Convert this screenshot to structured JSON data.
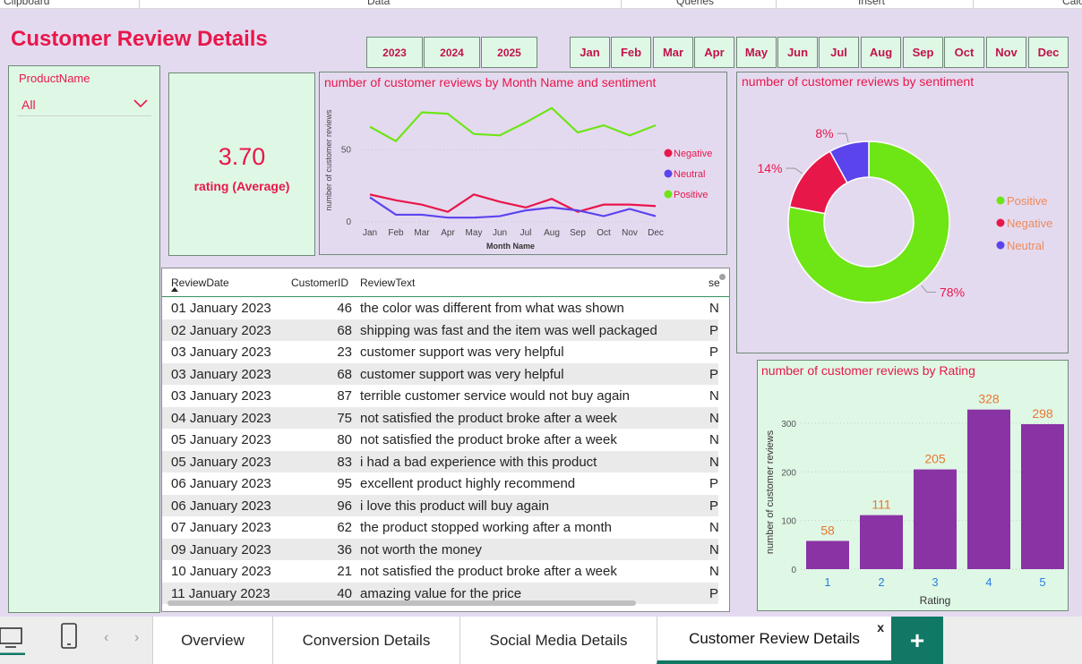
{
  "ribbon": {
    "groups": [
      "Clipboard",
      "Data",
      "Queries",
      "Insert",
      "Calc"
    ]
  },
  "page_title": "Customer Review Details",
  "year_buttons": [
    "2023",
    "2024",
    "2025"
  ],
  "month_buttons": [
    "Jan",
    "Feb",
    "Mar",
    "Apr",
    "May",
    "Jun",
    "Jul",
    "Aug",
    "Sep",
    "Oct",
    "Nov",
    "Dec"
  ],
  "slicer": {
    "title": "ProductName",
    "value": "All",
    "icon": "chevron-down-icon"
  },
  "kpi": {
    "value": "3.70",
    "label": "rating (Average)"
  },
  "colors": {
    "accent": "#e8174a",
    "positive": "#6ee515",
    "negative": "#e8174a",
    "neutral": "#5b44ee",
    "bar": "#8a33a5",
    "card_bg": "#dff8e6",
    "page_bg": "#e4daf0",
    "tab_active": "#117865"
  },
  "line_chart": {
    "title": "number of customer reviews by Month Name and sentiment",
    "chart_data": {
      "type": "line",
      "categories": [
        "Jan",
        "Feb",
        "Mar",
        "Apr",
        "May",
        "Jun",
        "Jul",
        "Aug",
        "Sep",
        "Oct",
        "Nov",
        "Dec"
      ],
      "series": [
        {
          "name": "Negative",
          "values": [
            19,
            15,
            12,
            7,
            19,
            14,
            10,
            16,
            7,
            12,
            12,
            11
          ]
        },
        {
          "name": "Neutral",
          "values": [
            17,
            5,
            5,
            3,
            3,
            4,
            8,
            10,
            8,
            4,
            9,
            4
          ]
        },
        {
          "name": "Positive",
          "values": [
            66,
            56,
            76,
            75,
            61,
            60,
            69,
            79,
            62,
            67,
            60,
            67
          ]
        }
      ],
      "xlabel": "Month Name",
      "ylabel": "number of customer reviews",
      "yticks": [
        "0",
        "50"
      ],
      "ylim": [
        0,
        85
      ],
      "legend": "right"
    }
  },
  "donut_chart": {
    "title": "number of customer reviews by sentiment",
    "chart_data": {
      "type": "pie",
      "labels": [
        "Positive",
        "Negative",
        "Neutral"
      ],
      "values": [
        78,
        14,
        8
      ],
      "data_labels": [
        "78%",
        "14%",
        "8%"
      ],
      "legend": "right"
    }
  },
  "bar_chart": {
    "title": "number of customer reviews by Rating",
    "chart_data": {
      "type": "bar",
      "categories": [
        "1",
        "2",
        "3",
        "4",
        "5"
      ],
      "values": [
        58,
        111,
        205,
        328,
        298
      ],
      "data_labels": [
        "58",
        "111",
        "205",
        "328",
        "298"
      ],
      "xlabel": "Rating",
      "ylabel": "number of customer reviews",
      "yticks": [
        "0",
        "100",
        "200",
        "300"
      ],
      "ylim": [
        0,
        355
      ]
    }
  },
  "table": {
    "columns": [
      "ReviewDate",
      "CustomerID",
      "ReviewText",
      "se"
    ],
    "rows": [
      [
        "01 January 2023",
        "46",
        "the color was different from what was shown",
        "N"
      ],
      [
        "02 January 2023",
        "68",
        "shipping was fast and the item was well packaged",
        "P"
      ],
      [
        "03 January 2023",
        "23",
        "customer support was very helpful",
        "P"
      ],
      [
        "03 January 2023",
        "68",
        "customer support was very helpful",
        "P"
      ],
      [
        "03 January 2023",
        "87",
        "terrible customer service would not buy again",
        "N"
      ],
      [
        "04 January 2023",
        "75",
        "not satisfied the product broke after a week",
        "N"
      ],
      [
        "05 January 2023",
        "80",
        "not satisfied the product broke after a week",
        "N"
      ],
      [
        "05 January 2023",
        "83",
        "i had a bad experience with this product",
        "N"
      ],
      [
        "06 January 2023",
        "95",
        "excellent product highly recommend",
        "P"
      ],
      [
        "06 January 2023",
        "96",
        "i love this product will buy again",
        "P"
      ],
      [
        "07 January 2023",
        "62",
        "the product stopped working after a month",
        "N"
      ],
      [
        "09 January 2023",
        "36",
        "not worth the money",
        "N"
      ],
      [
        "10 January 2023",
        "21",
        "not satisfied the product broke after a week",
        "N"
      ],
      [
        "11 January 2023",
        "40",
        "amazing value for the price",
        "P"
      ]
    ]
  },
  "tabs": {
    "items": [
      "Overview",
      "Conversion Details",
      "Social Media Details",
      "Customer Review Details"
    ],
    "active": "Customer Review Details",
    "close_label": "x",
    "add_label": "+"
  }
}
